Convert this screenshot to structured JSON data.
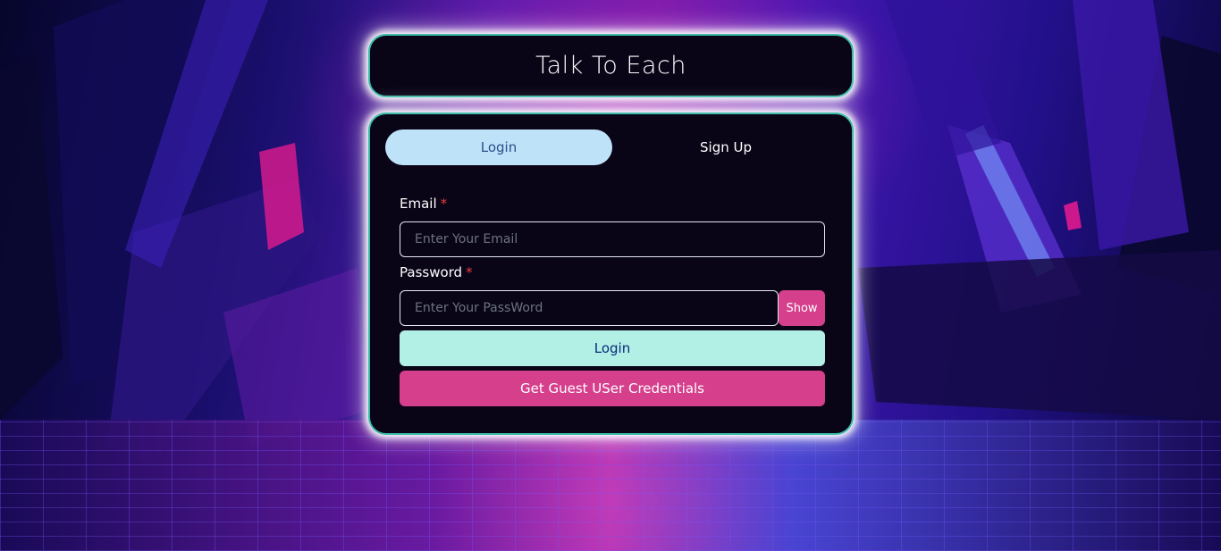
{
  "app": {
    "title": "Talk To Each"
  },
  "tabs": [
    {
      "label": "Login",
      "active": true
    },
    {
      "label": "Sign Up",
      "active": false
    }
  ],
  "form": {
    "email": {
      "label": "Email",
      "required_mark": "*",
      "placeholder": "Enter Your Email",
      "value": ""
    },
    "password": {
      "label": "Password",
      "required_mark": "*",
      "placeholder": "Enter Your PassWord",
      "value": "",
      "show_label": "Show"
    },
    "login_button": "Login",
    "guest_button": "Get Guest USer Credentials"
  },
  "colors": {
    "card_border": "#3cbca9",
    "active_tab": "#bee3f8",
    "login_button": "#b2f0e6",
    "accent_pink": "#d53f8c"
  }
}
